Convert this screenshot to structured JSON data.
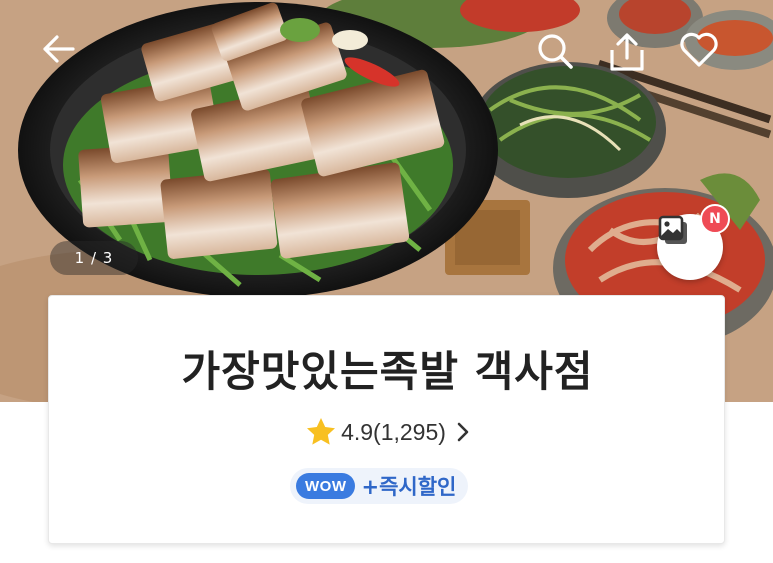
{
  "nav": {
    "back_icon": "arrow-left-icon",
    "search_icon": "search-icon",
    "share_icon": "share-icon",
    "favorite_icon": "heart-icon"
  },
  "hero": {
    "image_description_icon": "food-photo",
    "counter": "1 / 3",
    "photo_review_icon": "photo-gallery-icon",
    "new_badge": "N"
  },
  "store": {
    "name": "가장맛있는족발 객사점",
    "rating": "4.9",
    "review_count": "(1,295)",
    "star_color": "#f8c021"
  },
  "promo": {
    "wow_label": "WOW",
    "discount_label": "+즉시할인"
  },
  "colors": {
    "wow_bg": "#3a7be0",
    "promo_text": "#2f67c8",
    "badge": "#ef4b55"
  }
}
